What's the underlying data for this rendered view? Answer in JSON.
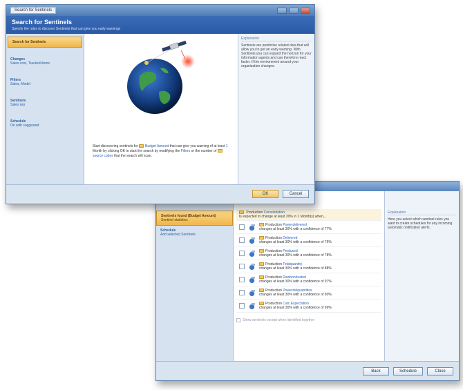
{
  "window1": {
    "titlebar_label": "Search for Sentinels",
    "header_title": "Search for Sentinels",
    "header_subtitle": "Specify the rules to discover Sentinels that can give you early warnings",
    "nav": [
      {
        "title": "Search for Sentinels",
        "sub": ""
      },
      {
        "title": "Changes",
        "sub": "Sales cost, Tracked items"
      },
      {
        "title": "Filters",
        "sub": "Sales, Model"
      },
      {
        "title": "Sentinels",
        "sub": "Sales rep"
      },
      {
        "title": "Schedule",
        "sub": "On with suggested"
      }
    ],
    "sentence": {
      "part1": "Start discovering sentinels for",
      "link1": "Budget Amount",
      "part2": "that can give you warning of at least",
      "link2": "1",
      "part3": "Month by clicking OK to start the search by modifying the",
      "link3": "Filters",
      "part4": "or the number of",
      "link4": "source cubes",
      "part5": "that the search will scan."
    },
    "explanation": {
      "title": "Explanation",
      "text": "Sentinels are predictive related data that will allow you to get an early warning. With Sentinels you can expand the horizon for your information agents and can therefore react faster. If the environment around your organization changes."
    },
    "buttons": {
      "ok": "OK",
      "cancel": "Cancel"
    }
  },
  "window2": {
    "nav": [
      {
        "title": "Sentinels found (Budget Amount)",
        "sub": "Sentinel statistics"
      },
      {
        "title": "Schedule",
        "sub": "Add selected Sentinels"
      }
    ],
    "top_item": {
      "line1": "Production",
      "link": "Consolidation",
      "line2": "Is expected to change at least 20% in 1 Month(s) when..."
    },
    "items": [
      {
        "name": "Production",
        "field": "Powerdelivered",
        "line2": "changes at least 30% with a confidence of 77%"
      },
      {
        "name": "Production",
        "field": "Delivered",
        "line2": "changes at least 30% with a confidence of 75%"
      },
      {
        "name": "Production",
        "field": "Produced",
        "line2": "changes at least 30% with a confidence of 78%"
      },
      {
        "name": "Production",
        "field": "Totalquantity",
        "line2": "changes at least 30% with a confidence of 88%"
      },
      {
        "name": "Production",
        "field": "Rawbonheated",
        "line2": "changes at least 30% with a confidence of 97%"
      },
      {
        "name": "Production",
        "field": "Powerdelquantities",
        "line2": "changes at least 30% with a confidence of 90%"
      },
      {
        "name": "Production",
        "field": "Calc Expectation",
        "line2": "changes at least 30% with a confidence of 99%"
      }
    ],
    "hidden_note": "Show sentinels except when identified together",
    "explanation": {
      "title": "Explanation",
      "text": "Here you select which sentinel rules you want to create schedules for any incoming automatic notification alerts."
    },
    "buttons": {
      "back": "Back",
      "schedule": "Schedule",
      "close": "Close"
    }
  },
  "colors": {
    "accent": "#3b6cb7",
    "active_step": "#f0b64a",
    "link": "#2a61b5",
    "window_bg": "#dde7f2"
  }
}
